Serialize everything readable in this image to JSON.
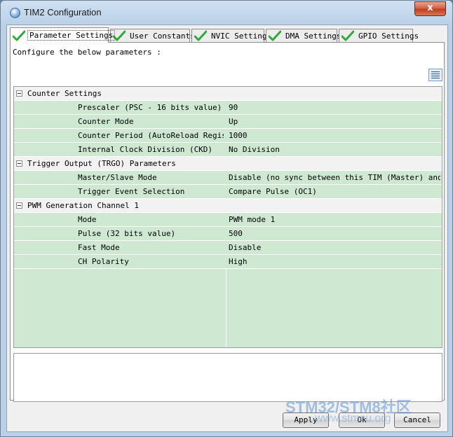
{
  "window": {
    "title": "TIM2 Configuration",
    "close_glyph": "x"
  },
  "tabs": [
    {
      "label": "Parameter Settings",
      "active": true
    },
    {
      "label": "User Constants",
      "active": false
    },
    {
      "label": "NVIC Settings",
      "active": false
    },
    {
      "label": "DMA Settings",
      "active": false
    },
    {
      "label": "GPIO Settings",
      "active": false
    }
  ],
  "panel": {
    "instruction": "Configure the below parameters :"
  },
  "groups": [
    {
      "label": "Counter Settings",
      "params": [
        {
          "name": "Prescaler (PSC - 16 bits value)",
          "value": "90"
        },
        {
          "name": "Counter Mode",
          "value": "Up"
        },
        {
          "name": "Counter Period (AutoReload Regis...",
          "value": "1000"
        },
        {
          "name": "Internal Clock Division (CKD)",
          "value": "No Division"
        }
      ]
    },
    {
      "label": "Trigger Output (TRGO) Parameters",
      "params": [
        {
          "name": "Master/Slave Mode",
          "value": "Disable (no sync between this TIM (Master) and ..."
        },
        {
          "name": "Trigger Event Selection",
          "value": "Compare Pulse (OC1)"
        }
      ]
    },
    {
      "label": "PWM Generation Channel 1",
      "params": [
        {
          "name": "Mode",
          "value": "PWM mode 1"
        },
        {
          "name": "Pulse (32 bits value)",
          "value": "500"
        },
        {
          "name": "Fast Mode",
          "value": "Disable"
        },
        {
          "name": "CH Polarity",
          "value": "High"
        }
      ]
    }
  ],
  "footer": {
    "apply_label": "Apply",
    "ok_label": "Ok",
    "cancel_label": "Cancel"
  },
  "watermark": {
    "text": "STM32/STM8社区",
    "url": "www.stmcu.org"
  },
  "colors": {
    "row_green": "#cfe8d2",
    "group_gray": "#f2f2f2",
    "check_green": "#2fa83a"
  },
  "icons": {
    "tab_status": "check-icon",
    "sort": "list-sort-icon",
    "expander": "collapse-minus-icon"
  }
}
